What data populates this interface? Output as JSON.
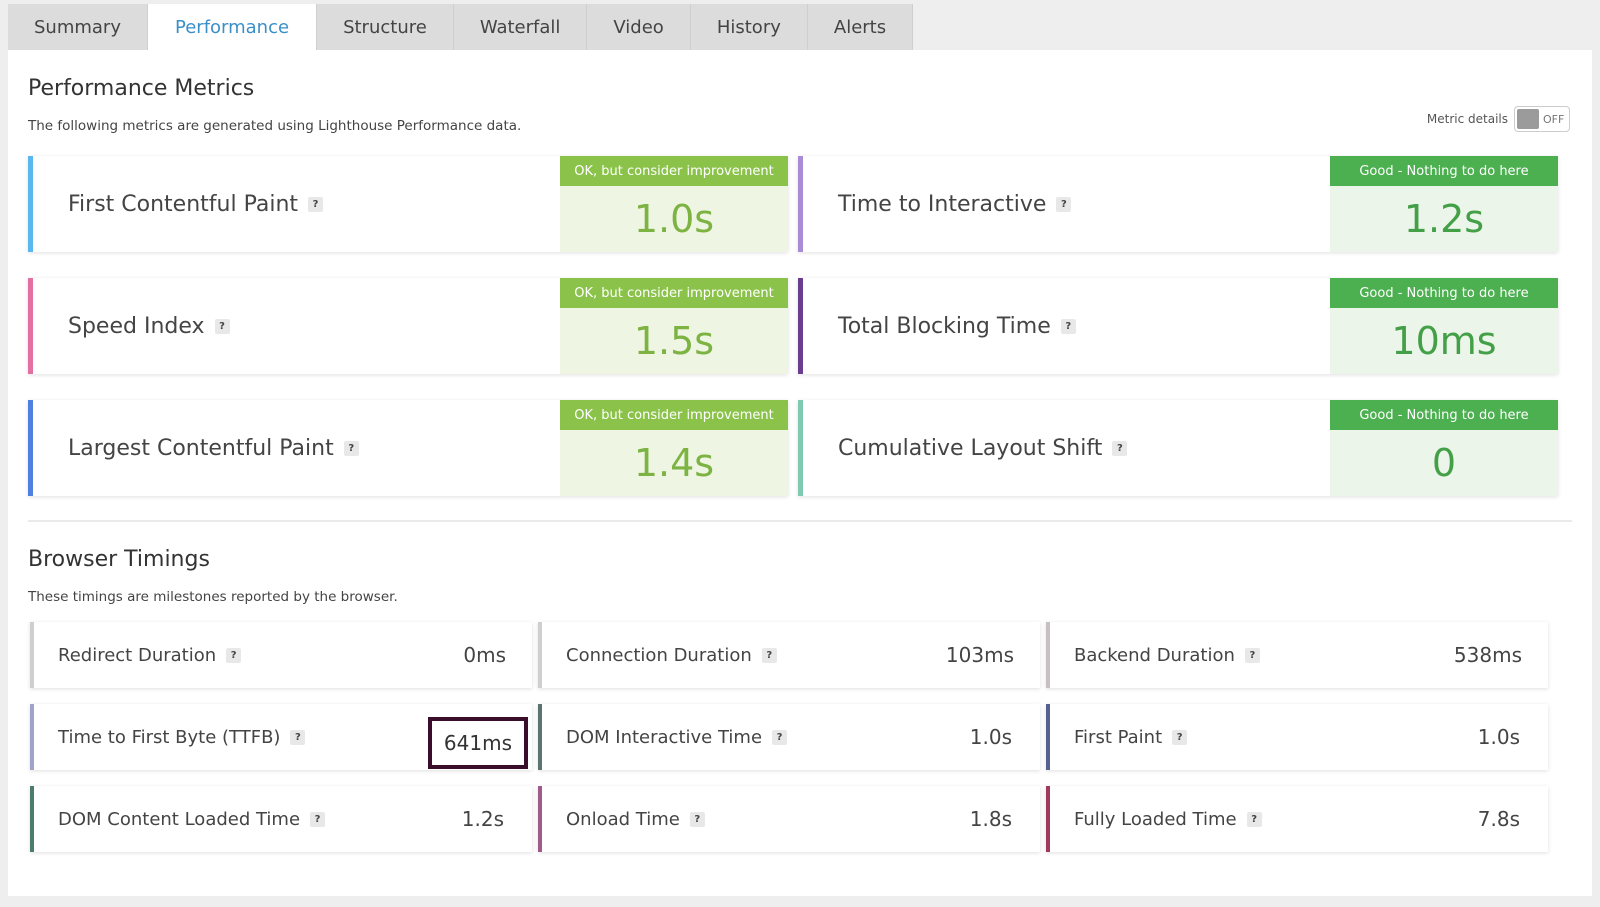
{
  "tabs": [
    {
      "label": "Summary",
      "active": false
    },
    {
      "label": "Performance",
      "active": true
    },
    {
      "label": "Structure",
      "active": false
    },
    {
      "label": "Waterfall",
      "active": false
    },
    {
      "label": "Video",
      "active": false
    },
    {
      "label": "History",
      "active": false
    },
    {
      "label": "Alerts",
      "active": false
    }
  ],
  "performance": {
    "title": "Performance Metrics",
    "description": "The following metrics are generated using Lighthouse Performance data.",
    "toggle_label": "Metric details",
    "toggle_state": "OFF",
    "metrics": [
      {
        "name": "First Contentful Paint",
        "grade": "OK, but consider improvement",
        "value": "1.0s",
        "status": "ok",
        "accent": "#5bb8ef"
      },
      {
        "name": "Time to Interactive",
        "grade": "Good - Nothing to do here",
        "value": "1.2s",
        "status": "good",
        "accent": "#a98bd6"
      },
      {
        "name": "Speed Index",
        "grade": "OK, but consider improvement",
        "value": "1.5s",
        "status": "ok",
        "accent": "#e46fa3"
      },
      {
        "name": "Total Blocking Time",
        "grade": "Good - Nothing to do here",
        "value": "10ms",
        "status": "good",
        "accent": "#6a3d8e"
      },
      {
        "name": "Largest Contentful Paint",
        "grade": "OK, but consider improvement",
        "value": "1.4s",
        "status": "ok",
        "accent": "#4f7fe0"
      },
      {
        "name": "Cumulative Layout Shift",
        "grade": "Good - Nothing to do here",
        "value": "0",
        "status": "good",
        "accent": "#7ecbb0"
      }
    ]
  },
  "browser": {
    "title": "Browser Timings",
    "description": "These timings are milestones reported by the browser.",
    "timings": [
      {
        "name": "Redirect Duration",
        "value": "0ms",
        "accent": "#cfcfcf"
      },
      {
        "name": "Connection Duration",
        "value": "103ms",
        "accent": "#cfcfcf"
      },
      {
        "name": "Backend Duration",
        "value": "538ms",
        "accent": "#c8c0c0"
      },
      {
        "name": "Time to First Byte (TTFB)",
        "value": "641ms",
        "accent": "#9ea3c9"
      },
      {
        "name": "DOM Interactive Time",
        "value": "1.0s",
        "accent": "#5a7471"
      },
      {
        "name": "First Paint",
        "value": "1.0s",
        "accent": "#56628e"
      },
      {
        "name": "DOM Content Loaded Time",
        "value": "1.2s",
        "accent": "#4b7c6d"
      },
      {
        "name": "Onload Time",
        "value": "1.8s",
        "accent": "#a05a8c"
      },
      {
        "name": "Fully Loaded Time",
        "value": "7.8s",
        "accent": "#a03a5c"
      }
    ]
  },
  "colors": {
    "tab_active_text": "#3a8fc8",
    "ok_label_bg": "#8bc34a",
    "good_label_bg": "#4caf50",
    "highlight_border": "#3a0d2b"
  }
}
